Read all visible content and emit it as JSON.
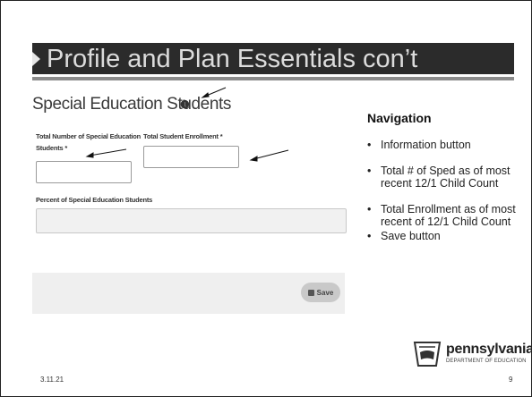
{
  "slide": {
    "title": "Profile and Plan Essentials con’t",
    "date": "3.11.21",
    "page_number": "9"
  },
  "form": {
    "section_title": "Special Education Students",
    "info_icon": "info-icon",
    "fields": [
      {
        "label_line1": "Total Number of Special Education",
        "label_line2": "Students *",
        "value": ""
      },
      {
        "label": "Total Student Enrollment *",
        "value": ""
      },
      {
        "label": "Percent of Special Education Students",
        "value": ""
      }
    ],
    "save_label": "Save"
  },
  "navigation": {
    "heading": "Navigation",
    "items": [
      "Information button",
      "Total # of Sped as of most recent 12/1 Child Count",
      "Total Enrollment as of most recent of 12/1 Child Count",
      "Save button"
    ]
  },
  "logo": {
    "name": "pennsylvania",
    "subtitle": "DEPARTMENT OF EDUCATION"
  },
  "colors": {
    "title_bar": "#2b2b2b",
    "title_text": "#dcdcdc",
    "panel": "#efefef",
    "button": "#c9c9c9"
  }
}
